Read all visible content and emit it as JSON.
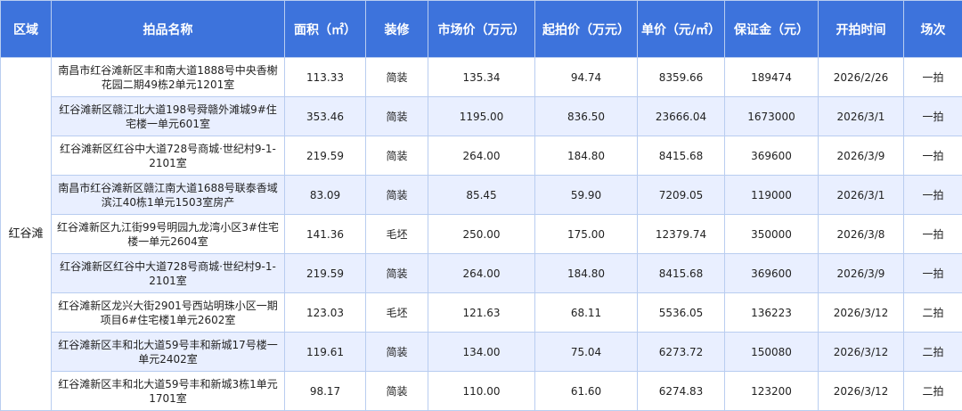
{
  "headers": [
    "区域",
    "拍品名称",
    "面积（㎡）",
    "装修",
    "市场价（万元）",
    "起拍价（万元）",
    "单价（元/㎡）",
    "保证金（元）",
    "开拍时间",
    "场次"
  ],
  "region": "红谷滩",
  "rows": [
    {
      "name": "南昌市红谷滩新区丰和南大道1888号中央香榭花园二期49栋2单元1201室",
      "area": "113.33",
      "decor": "简装",
      "market": "135.34",
      "start": "94.74",
      "unit": "8359.66",
      "deposit": "189474",
      "date": "2026/2/26",
      "session": "一拍"
    },
    {
      "name": "红谷滩新区赣江北大道198号舜赣外滩城9#住宅楼一单元601室",
      "area": "353.46",
      "decor": "简装",
      "market": "1195.00",
      "start": "836.50",
      "unit": "23666.04",
      "deposit": "1673000",
      "date": "2026/3/1",
      "session": "一拍"
    },
    {
      "name": "红谷滩新区红谷中大道728号商城·世纪村9-1-2101室",
      "area": "219.59",
      "decor": "简装",
      "market": "264.00",
      "start": "184.80",
      "unit": "8415.68",
      "deposit": "369600",
      "date": "2026/3/9",
      "session": "一拍"
    },
    {
      "name": "南昌市红谷滩新区赣江南大道1688号联泰香域滨江40栋1单元1503室房产",
      "area": "83.09",
      "decor": "简装",
      "market": "85.45",
      "start": "59.90",
      "unit": "7209.05",
      "deposit": "119000",
      "date": "2026/3/1",
      "session": "一拍"
    },
    {
      "name": "红谷滩新区九江街99号明园九龙湾小区3#住宅楼一单元2604室",
      "area": "141.36",
      "decor": "毛坯",
      "market": "250.00",
      "start": "175.00",
      "unit": "12379.74",
      "deposit": "350000",
      "date": "2026/3/8",
      "session": "一拍"
    },
    {
      "name": "红谷滩新区红谷中大道728号商城·世纪村9-1-2101室",
      "area": "219.59",
      "decor": "简装",
      "market": "264.00",
      "start": "184.80",
      "unit": "8415.68",
      "deposit": "369600",
      "date": "2026/3/9",
      "session": "一拍"
    },
    {
      "name": "红谷滩新区龙兴大街2901号西站明珠小区一期项目6#住宅楼1单元2602室",
      "area": "123.03",
      "decor": "毛坯",
      "market": "121.63",
      "start": "68.11",
      "unit": "5536.05",
      "deposit": "136223",
      "date": "2026/3/12",
      "session": "二拍"
    },
    {
      "name": "红谷滩新区丰和北大道59号丰和新城17号楼一单元2402室",
      "area": "119.61",
      "decor": "简装",
      "market": "134.00",
      "start": "75.04",
      "unit": "6273.72",
      "deposit": "150080",
      "date": "2026/3/12",
      "session": "二拍"
    },
    {
      "name": "红谷滩新区丰和北大道59号丰和新城3栋1单元1701室",
      "area": "98.17",
      "decor": "简装",
      "market": "110.00",
      "start": "61.60",
      "unit": "6274.83",
      "deposit": "123200",
      "date": "2026/3/12",
      "session": "二拍"
    }
  ]
}
